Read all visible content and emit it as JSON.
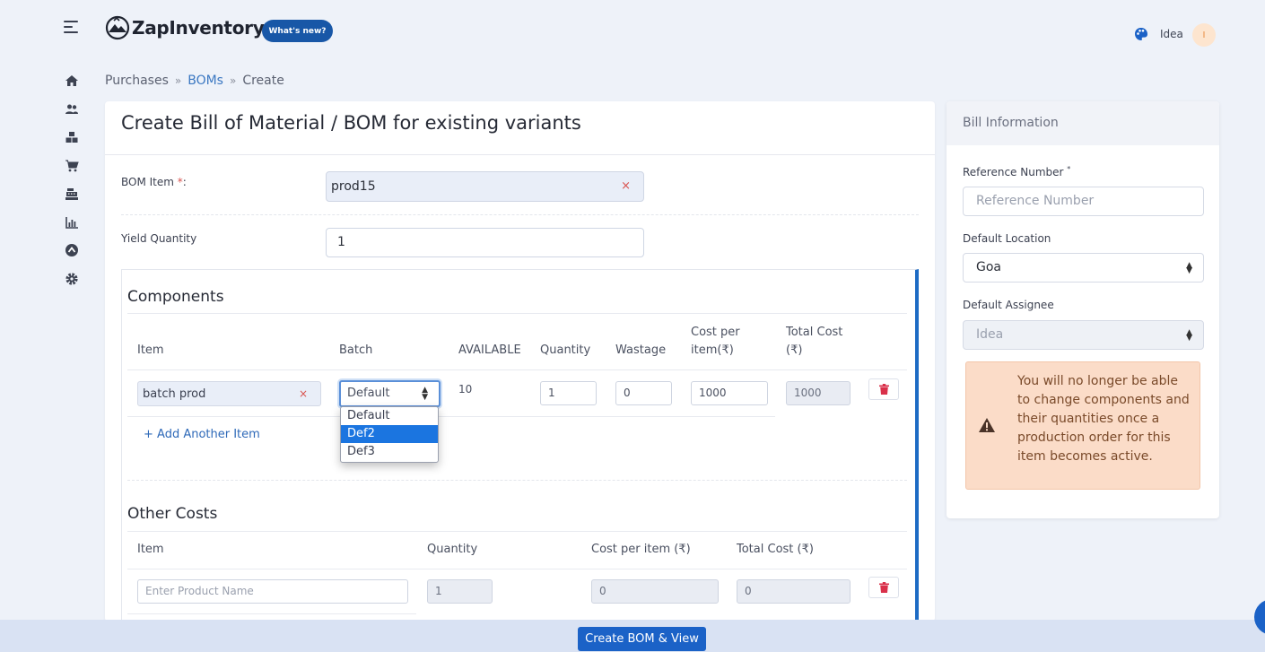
{
  "header": {
    "app_name": "ZapInventory",
    "whats_new": "What's new?",
    "user_name": "Idea",
    "avatar_initial": "I"
  },
  "nav": {
    "icons": [
      "home-icon",
      "users-icon",
      "boxes-icon",
      "cart-icon",
      "cash-register-icon",
      "chart-icon",
      "arrow-circle-icon",
      "gear-icon"
    ]
  },
  "breadcrumb": {
    "items": [
      "Purchases",
      "BOMs",
      "Create"
    ],
    "separator": "»"
  },
  "form": {
    "title": "Create Bill of Material / BOM for existing variants",
    "bom_item_label": "BOM Item ",
    "bom_item_required": "*",
    "bom_item_colon": ":",
    "bom_item_value": "prod15",
    "clear_symbol": "×",
    "yield_label": "Yield Quantity",
    "yield_value": "1"
  },
  "components": {
    "title": "Components",
    "headers": {
      "item": "Item",
      "batch": "Batch",
      "available": "AVAILABLE",
      "quantity": "Quantity",
      "wastage": "Wastage",
      "cost_per_item_1": "Cost per",
      "cost_per_item_2": "item(₹)",
      "total_cost_1": "Total Cost",
      "total_cost_2": "(₹)"
    },
    "row": {
      "item": "batch prod",
      "batch": "Default",
      "available": "10",
      "quantity": "1",
      "wastage": "0",
      "cost_per_item": "1000",
      "total_cost": "1000"
    },
    "batch_options": [
      "Default",
      "Def2",
      "Def3"
    ],
    "batch_highlighted": "Def2",
    "add_item": "+ Add Another Item"
  },
  "other_costs": {
    "title": "Other Costs",
    "headers": {
      "item": "Item",
      "quantity": "Quantity",
      "cost_per_item": "Cost per item (₹)",
      "total_cost": "Total Cost (₹)"
    },
    "row": {
      "item_placeholder": "Enter Product Name",
      "quantity": "1",
      "cost_per_item": "0",
      "total_cost": "0"
    }
  },
  "bill_info": {
    "title": "Bill Information",
    "reference_label": "Reference Number",
    "reference_required": "*",
    "reference_placeholder": "Reference Number",
    "location_label": "Default Location",
    "location_value": "Goa",
    "assignee_label": "Default Assignee",
    "assignee_value": "Idea",
    "warning": "You will no longer be able to change components and their quantities once a production order for this item becomes active."
  },
  "footer": {
    "create_button": "Create BOM & View"
  },
  "colors": {
    "accent": "#1b62c7",
    "danger": "#d9534f",
    "warning_bg": "#fbdcc8"
  }
}
